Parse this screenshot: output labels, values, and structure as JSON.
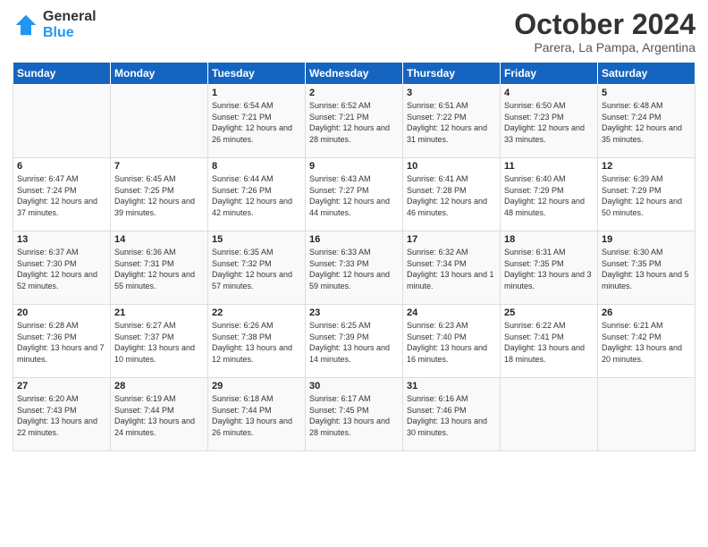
{
  "logo": {
    "general": "General",
    "blue": "Blue"
  },
  "header": {
    "month": "October 2024",
    "location": "Parera, La Pampa, Argentina"
  },
  "days_of_week": [
    "Sunday",
    "Monday",
    "Tuesday",
    "Wednesday",
    "Thursday",
    "Friday",
    "Saturday"
  ],
  "weeks": [
    [
      {
        "day": "",
        "info": ""
      },
      {
        "day": "",
        "info": ""
      },
      {
        "day": "1",
        "info": "Sunrise: 6:54 AM\nSunset: 7:21 PM\nDaylight: 12 hours\nand 26 minutes."
      },
      {
        "day": "2",
        "info": "Sunrise: 6:52 AM\nSunset: 7:21 PM\nDaylight: 12 hours\nand 28 minutes."
      },
      {
        "day": "3",
        "info": "Sunrise: 6:51 AM\nSunset: 7:22 PM\nDaylight: 12 hours\nand 31 minutes."
      },
      {
        "day": "4",
        "info": "Sunrise: 6:50 AM\nSunset: 7:23 PM\nDaylight: 12 hours\nand 33 minutes."
      },
      {
        "day": "5",
        "info": "Sunrise: 6:48 AM\nSunset: 7:24 PM\nDaylight: 12 hours\nand 35 minutes."
      }
    ],
    [
      {
        "day": "6",
        "info": "Sunrise: 6:47 AM\nSunset: 7:24 PM\nDaylight: 12 hours\nand 37 minutes."
      },
      {
        "day": "7",
        "info": "Sunrise: 6:45 AM\nSunset: 7:25 PM\nDaylight: 12 hours\nand 39 minutes."
      },
      {
        "day": "8",
        "info": "Sunrise: 6:44 AM\nSunset: 7:26 PM\nDaylight: 12 hours\nand 42 minutes."
      },
      {
        "day": "9",
        "info": "Sunrise: 6:43 AM\nSunset: 7:27 PM\nDaylight: 12 hours\nand 44 minutes."
      },
      {
        "day": "10",
        "info": "Sunrise: 6:41 AM\nSunset: 7:28 PM\nDaylight: 12 hours\nand 46 minutes."
      },
      {
        "day": "11",
        "info": "Sunrise: 6:40 AM\nSunset: 7:29 PM\nDaylight: 12 hours\nand 48 minutes."
      },
      {
        "day": "12",
        "info": "Sunrise: 6:39 AM\nSunset: 7:29 PM\nDaylight: 12 hours\nand 50 minutes."
      }
    ],
    [
      {
        "day": "13",
        "info": "Sunrise: 6:37 AM\nSunset: 7:30 PM\nDaylight: 12 hours\nand 52 minutes."
      },
      {
        "day": "14",
        "info": "Sunrise: 6:36 AM\nSunset: 7:31 PM\nDaylight: 12 hours\nand 55 minutes."
      },
      {
        "day": "15",
        "info": "Sunrise: 6:35 AM\nSunset: 7:32 PM\nDaylight: 12 hours\nand 57 minutes."
      },
      {
        "day": "16",
        "info": "Sunrise: 6:33 AM\nSunset: 7:33 PM\nDaylight: 12 hours\nand 59 minutes."
      },
      {
        "day": "17",
        "info": "Sunrise: 6:32 AM\nSunset: 7:34 PM\nDaylight: 13 hours\nand 1 minute."
      },
      {
        "day": "18",
        "info": "Sunrise: 6:31 AM\nSunset: 7:35 PM\nDaylight: 13 hours\nand 3 minutes."
      },
      {
        "day": "19",
        "info": "Sunrise: 6:30 AM\nSunset: 7:35 PM\nDaylight: 13 hours\nand 5 minutes."
      }
    ],
    [
      {
        "day": "20",
        "info": "Sunrise: 6:28 AM\nSunset: 7:36 PM\nDaylight: 13 hours\nand 7 minutes."
      },
      {
        "day": "21",
        "info": "Sunrise: 6:27 AM\nSunset: 7:37 PM\nDaylight: 13 hours\nand 10 minutes."
      },
      {
        "day": "22",
        "info": "Sunrise: 6:26 AM\nSunset: 7:38 PM\nDaylight: 13 hours\nand 12 minutes."
      },
      {
        "day": "23",
        "info": "Sunrise: 6:25 AM\nSunset: 7:39 PM\nDaylight: 13 hours\nand 14 minutes."
      },
      {
        "day": "24",
        "info": "Sunrise: 6:23 AM\nSunset: 7:40 PM\nDaylight: 13 hours\nand 16 minutes."
      },
      {
        "day": "25",
        "info": "Sunrise: 6:22 AM\nSunset: 7:41 PM\nDaylight: 13 hours\nand 18 minutes."
      },
      {
        "day": "26",
        "info": "Sunrise: 6:21 AM\nSunset: 7:42 PM\nDaylight: 13 hours\nand 20 minutes."
      }
    ],
    [
      {
        "day": "27",
        "info": "Sunrise: 6:20 AM\nSunset: 7:43 PM\nDaylight: 13 hours\nand 22 minutes."
      },
      {
        "day": "28",
        "info": "Sunrise: 6:19 AM\nSunset: 7:44 PM\nDaylight: 13 hours\nand 24 minutes."
      },
      {
        "day": "29",
        "info": "Sunrise: 6:18 AM\nSunset: 7:44 PM\nDaylight: 13 hours\nand 26 minutes."
      },
      {
        "day": "30",
        "info": "Sunrise: 6:17 AM\nSunset: 7:45 PM\nDaylight: 13 hours\nand 28 minutes."
      },
      {
        "day": "31",
        "info": "Sunrise: 6:16 AM\nSunset: 7:46 PM\nDaylight: 13 hours\nand 30 minutes."
      },
      {
        "day": "",
        "info": ""
      },
      {
        "day": "",
        "info": ""
      }
    ]
  ]
}
